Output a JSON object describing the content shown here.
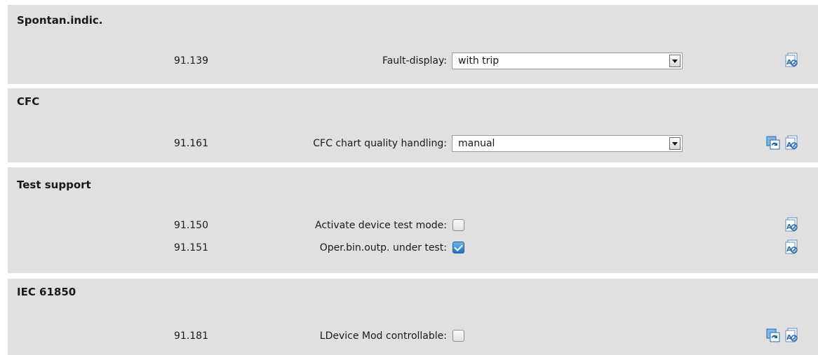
{
  "groups": [
    {
      "title": "Spontan.indic.",
      "params": [
        {
          "id": "91.139",
          "label": "Fault-display:",
          "control": "dropdown",
          "value": "with trip",
          "icons": [
            "properties-disabled-icon"
          ]
        }
      ]
    },
    {
      "title": "CFC",
      "params": [
        {
          "id": "91.161",
          "label": "CFC chart quality handling:",
          "control": "dropdown",
          "value": "manual",
          "icons": [
            "sync-icon",
            "properties-disabled-icon"
          ]
        }
      ]
    },
    {
      "title": "Test support",
      "params": [
        {
          "id": "91.150",
          "label": "Activate device test mode:",
          "control": "checkbox",
          "checked": false,
          "icons": [
            "properties-disabled-icon"
          ]
        },
        {
          "id": "91.151",
          "label": "Oper.bin.outp. under test:",
          "control": "checkbox",
          "checked": true,
          "icons": [
            "properties-disabled-icon"
          ]
        }
      ]
    },
    {
      "title": "IEC 61850",
      "params": [
        {
          "id": "91.181",
          "label": "LDevice Mod controllable:",
          "control": "checkbox",
          "checked": false,
          "icons": [
            "sync-icon",
            "properties-disabled-icon"
          ]
        }
      ]
    }
  ],
  "colors": {
    "panel": "#e0e0e0",
    "separator": "#ffffff",
    "checkbox_checked": "#1f72c8",
    "icon_blue": "#2a78d0"
  }
}
